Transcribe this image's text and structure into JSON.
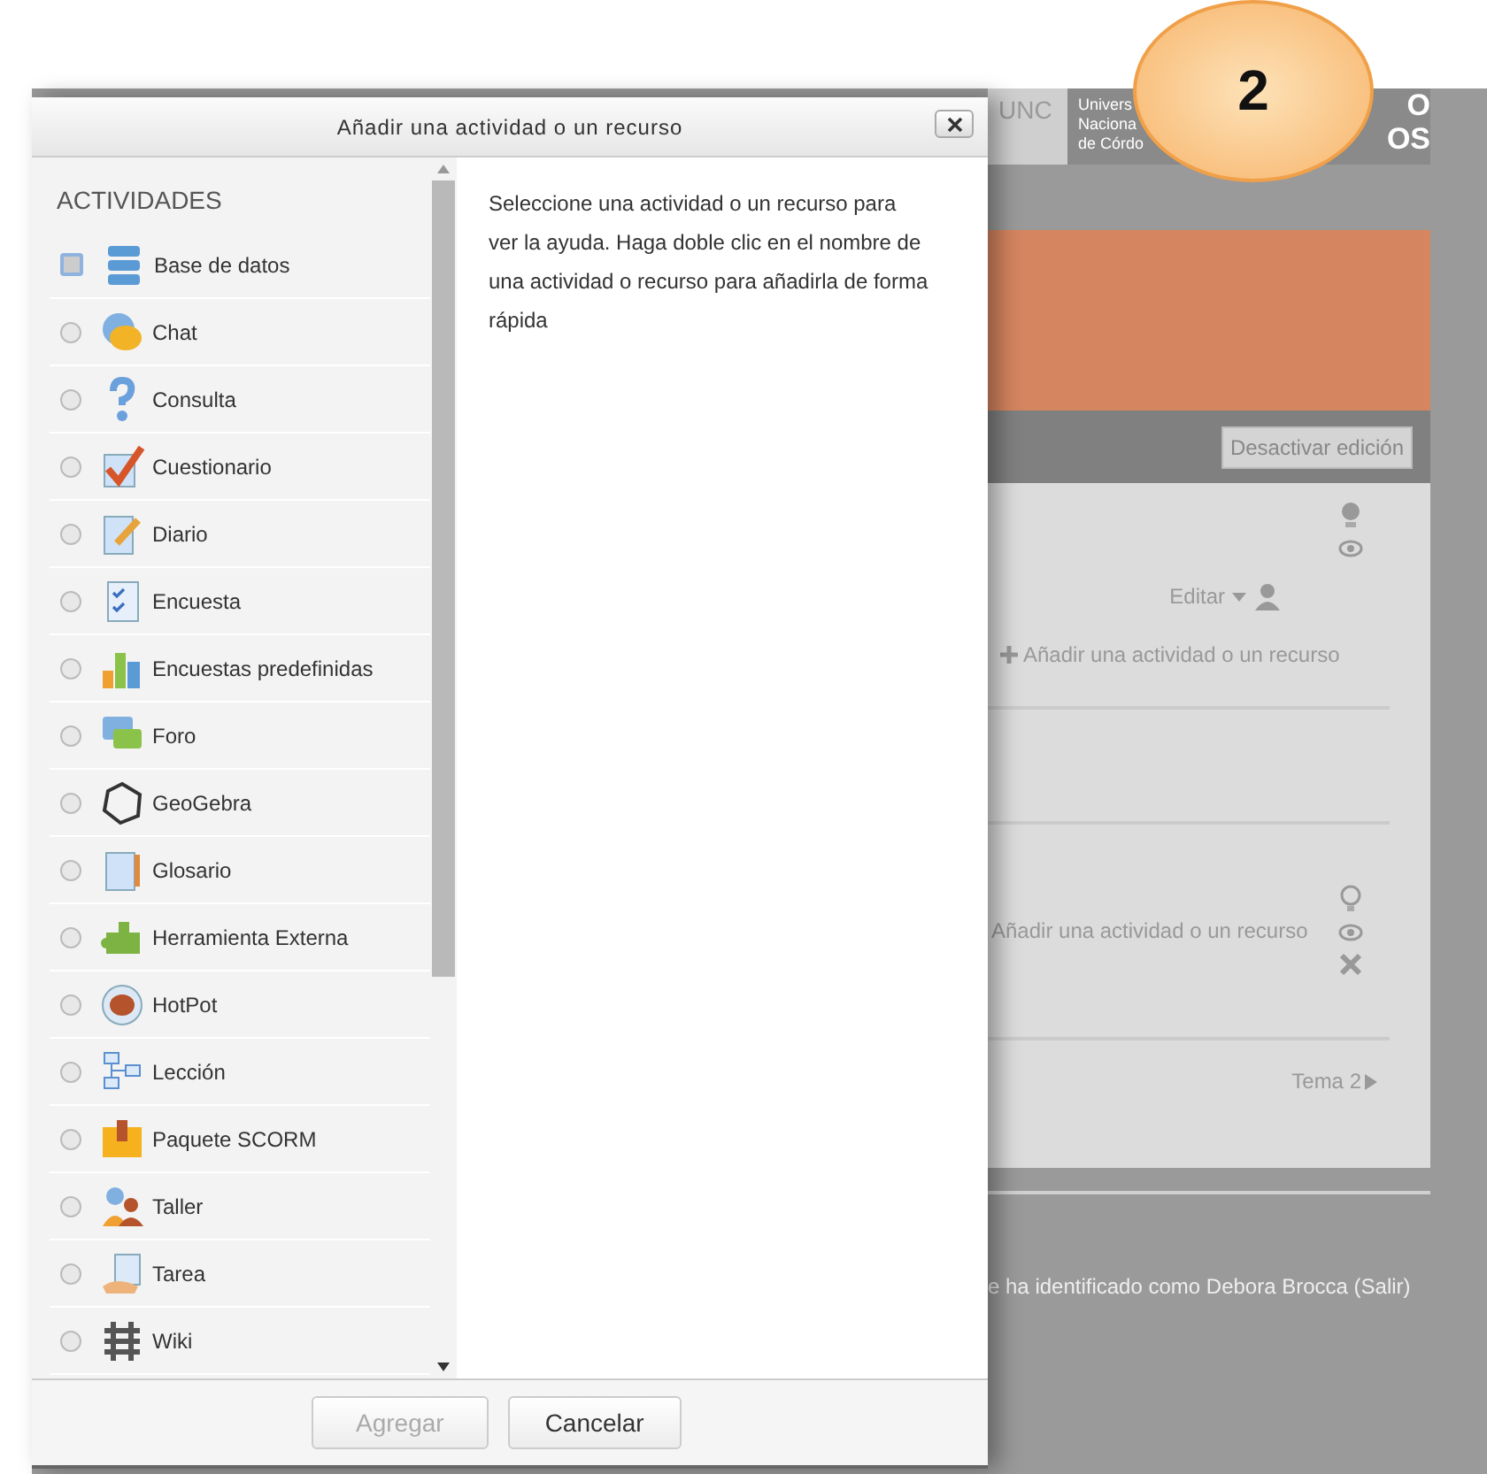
{
  "callout": {
    "label": "2"
  },
  "background_page": {
    "logo_short": "UNC",
    "logo_lines": [
      "Univers",
      "Naciona",
      "de Córdo"
    ],
    "logo_large": [
      "O",
      "OS"
    ],
    "edit_button": "Desactivar edición",
    "edit_menu": "Editar",
    "add_links": [
      "Añadir una actividad o un recurso",
      "Añadir una actividad o un recurso"
    ],
    "next_link": "Tema 2",
    "footer": "e ha identificado como Debora Brocca (Salir)"
  },
  "dialog": {
    "title": "Añadir una actividad o un recurso",
    "section_title": "ACTIVIDADES",
    "items": [
      {
        "label": "Base de datos",
        "selected": true
      },
      {
        "label": "Chat",
        "selected": false
      },
      {
        "label": "Consulta",
        "selected": false
      },
      {
        "label": "Cuestionario",
        "selected": false
      },
      {
        "label": "Diario",
        "selected": false
      },
      {
        "label": "Encuesta",
        "selected": false
      },
      {
        "label": "Encuestas predefinidas",
        "selected": false
      },
      {
        "label": "Foro",
        "selected": false
      },
      {
        "label": "GeoGebra",
        "selected": false
      },
      {
        "label": "Glosario",
        "selected": false
      },
      {
        "label": "Herramienta Externa",
        "selected": false
      },
      {
        "label": "HotPot",
        "selected": false
      },
      {
        "label": "Lección",
        "selected": false
      },
      {
        "label": "Paquete SCORM",
        "selected": false
      },
      {
        "label": "Taller",
        "selected": false
      },
      {
        "label": "Tarea",
        "selected": false
      },
      {
        "label": "Wiki",
        "selected": false
      }
    ],
    "help_text": "Seleccione una actividad o un recurso para ver la ayuda. Haga doble clic en el nombre de una actividad o recurso para añadirla de forma rápida",
    "buttons": [
      {
        "label": "Agregar",
        "disabled": true
      },
      {
        "label": "Cancelar",
        "disabled": false
      }
    ]
  }
}
